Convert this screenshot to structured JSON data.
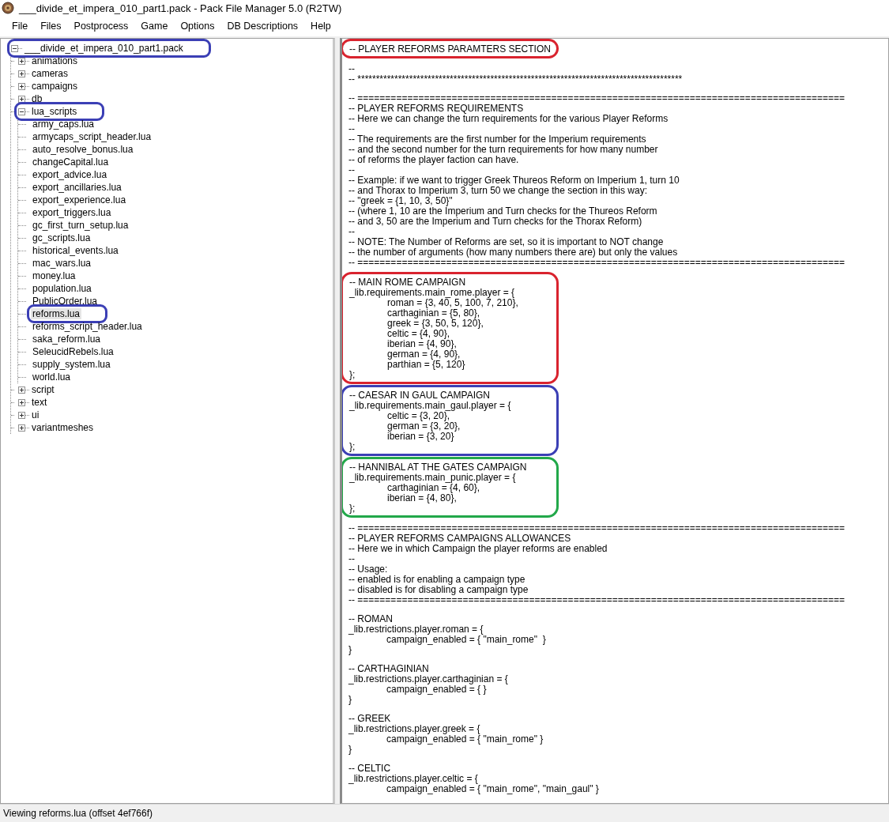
{
  "window": {
    "title": "___divide_et_impera_010_part1.pack - Pack File Manager 5.0 (R2TW)"
  },
  "menu": [
    "File",
    "Files",
    "Postprocess",
    "Game",
    "Options",
    "DB Descriptions",
    "Help"
  ],
  "tree": {
    "items": [
      {
        "label": "___divide_et_impera_010_part1.pack",
        "kind": "folder",
        "expanded": true,
        "selected": false,
        "color": "#3b3fb5",
        "children": [
          {
            "label": "animations",
            "kind": "folder",
            "expanded": false,
            "selected": false
          },
          {
            "label": "cameras",
            "kind": "folder",
            "expanded": false,
            "selected": false
          },
          {
            "label": "campaigns",
            "kind": "folder",
            "expanded": false,
            "selected": false
          },
          {
            "label": "db",
            "kind": "folder",
            "expanded": false,
            "selected": false
          },
          {
            "label": "lua_scripts",
            "kind": "folder",
            "expanded": true,
            "selected": false,
            "color": "#3b3fb5",
            "children": [
              {
                "label": "army_caps.lua",
                "kind": "file",
                "selected": false
              },
              {
                "label": "armycaps_script_header.lua",
                "kind": "file",
                "selected": false
              },
              {
                "label": "auto_resolve_bonus.lua",
                "kind": "file",
                "selected": false
              },
              {
                "label": "changeCapital.lua",
                "kind": "file",
                "selected": false
              },
              {
                "label": "export_advice.lua",
                "kind": "file",
                "selected": false
              },
              {
                "label": "export_ancillaries.lua",
                "kind": "file",
                "selected": false
              },
              {
                "label": "export_experience.lua",
                "kind": "file",
                "selected": false
              },
              {
                "label": "export_triggers.lua",
                "kind": "file",
                "selected": false
              },
              {
                "label": "gc_first_turn_setup.lua",
                "kind": "file",
                "selected": false
              },
              {
                "label": "gc_scripts.lua",
                "kind": "file",
                "selected": false
              },
              {
                "label": "historical_events.lua",
                "kind": "file",
                "selected": false
              },
              {
                "label": "mac_wars.lua",
                "kind": "file",
                "selected": false
              },
              {
                "label": "money.lua",
                "kind": "file",
                "selected": false
              },
              {
                "label": "population.lua",
                "kind": "file",
                "selected": false
              },
              {
                "label": "PublicOrder.lua",
                "kind": "file",
                "selected": false
              },
              {
                "label": "reforms.lua",
                "kind": "file",
                "selected": true,
                "color": "#3b3fb5"
              },
              {
                "label": "reforms_script_header.lua",
                "kind": "file",
                "selected": false
              },
              {
                "label": "saka_reform.lua",
                "kind": "file",
                "selected": false
              },
              {
                "label": "SeleucidRebels.lua",
                "kind": "file",
                "selected": false
              },
              {
                "label": "supply_system.lua",
                "kind": "file",
                "selected": false
              },
              {
                "label": "world.lua",
                "kind": "file",
                "selected": false
              }
            ]
          },
          {
            "label": "script",
            "kind": "folder",
            "expanded": false,
            "selected": false
          },
          {
            "label": "text",
            "kind": "folder",
            "expanded": false,
            "selected": false
          },
          {
            "label": "ui",
            "kind": "folder",
            "expanded": false,
            "selected": false
          },
          {
            "label": "variantmeshes",
            "kind": "folder",
            "expanded": false,
            "selected": false
          }
        ]
      }
    ]
  },
  "editor": {
    "blocks": [
      {
        "color": "#d9232e",
        "lines": [
          "-- PLAYER REFORMS PARAMTERS SECTION"
        ]
      },
      {
        "lines": [
          "--",
          "-- ****************************************************************************************"
        ]
      },
      {
        "lines": [
          "-- ========================================================================================",
          "-- PLAYER REFORMS REQUIREMENTS",
          "-- Here we can change the turn requirements for the various Player Reforms",
          "--",
          "-- The requirements are the first number for the Imperium requirements",
          "-- and the second number for the turn requirements for how many number",
          "-- of reforms the player faction can have.",
          "--",
          "-- Example: if we want to trigger Greek Thureos Reform on Imperium 1, turn 10",
          "-- and Thorax to Imperium 3, turn 50 we change the section in this way:",
          "-- \"greek = {1, 10, 3, 50}\"",
          "-- (where 1, 10 are the Imperium and Turn checks for the Thureos Reform",
          "-- and 3, 50 are the Imperium and Turn checks for the Thorax Reform)",
          "--",
          "-- NOTE: The Number of Reforms are set, so it is important to NOT change",
          "-- the number of arguments (how many numbers there are) but only the values",
          "-- ========================================================================================"
        ]
      },
      {
        "color": "#d9232e",
        "lines": [
          "-- MAIN ROME CAMPAIGN",
          "_lib.requirements.main_rome.player = {",
          "\troman = {3, 40, 5, 100, 7, 210},",
          "\tcarthaginian = {5, 80},",
          "\tgreek = {3, 50, 5, 120},",
          "\tceltic = {4, 90},",
          "\tiberian = {4, 90},",
          "\tgerman = {4, 90},",
          "\tparthian = {5, 120}",
          "};"
        ]
      },
      {
        "color": "#3b3fb5",
        "lines": [
          "-- CAESAR IN GAUL CAMPAIGN",
          "_lib.requirements.main_gaul.player = {",
          "\tceltic = {3, 20},",
          "\tgerman = {3, 20},",
          "\tiberian = {3, 20}",
          "};"
        ]
      },
      {
        "color": "#22a84a",
        "lines": [
          "-- HANNIBAL AT THE GATES CAMPAIGN",
          "_lib.requirements.main_punic.player = {",
          "\tcarthaginian = {4, 60},",
          "\tiberian = {4, 80},",
          "};"
        ]
      },
      {
        "lines": [
          "-- ========================================================================================",
          "-- PLAYER REFORMS CAMPAIGNS ALLOWANCES",
          "-- Here we in which Campaign the player reforms are enabled",
          "--",
          "-- Usage:",
          "-- enabled is for enabling a campaign type",
          "-- disabled is for disabling a campaign type",
          "-- ========================================================================================"
        ]
      },
      {
        "lines": [
          "-- ROMAN",
          "_lib.restrictions.player.roman = {",
          "\tcampaign_enabled = { \"main_rome\"  }",
          "}"
        ]
      },
      {
        "lines": [
          "-- CARTHAGINIAN",
          "_lib.restrictions.player.carthaginian = {",
          "\tcampaign_enabled = { }",
          "}"
        ]
      },
      {
        "lines": [
          "-- GREEK",
          "_lib.restrictions.player.greek = {",
          "\tcampaign_enabled = { \"main_rome\" }",
          "}"
        ]
      },
      {
        "lines": [
          "-- CELTIC",
          "_lib.restrictions.player.celtic = {",
          "\tcampaign_enabled = { \"main_rome\", \"main_gaul\" }"
        ]
      }
    ]
  },
  "status_bar": "Viewing reforms.lua (offset 4ef766f)"
}
